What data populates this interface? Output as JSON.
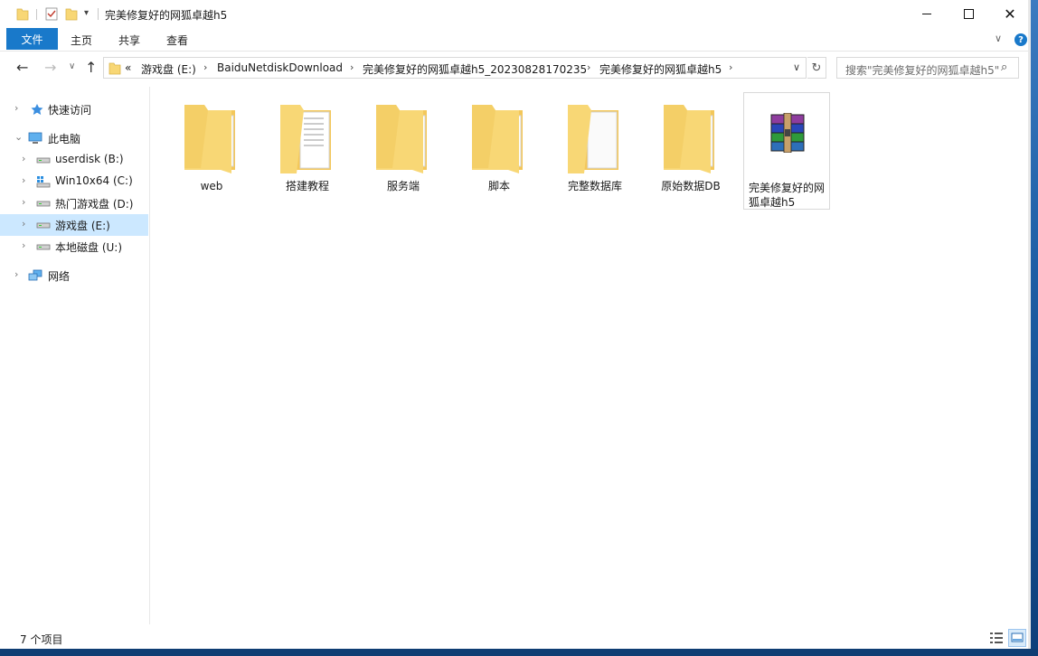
{
  "window": {
    "title": "完美修复好的网狐卓越h5"
  },
  "ribbon": {
    "file_tab": "文件",
    "tabs": [
      "主页",
      "共享",
      "查看"
    ]
  },
  "address": {
    "overflow": "«",
    "crumbs": [
      "游戏盘 (E:)",
      "BaiduNetdiskDownload",
      "完美修复好的网狐卓越h5_20230828170235",
      "完美修复好的网狐卓越h5"
    ]
  },
  "search": {
    "placeholder": "搜索\"完美修复好的网狐卓越h5\""
  },
  "sidebar": {
    "items": [
      {
        "label": "快速访问",
        "icon": "star-icon"
      },
      {
        "label": "此电脑",
        "icon": "computer-icon"
      },
      {
        "label": "userdisk (B:)",
        "icon": "drive-icon"
      },
      {
        "label": "Win10x64 (C:)",
        "icon": "windows-drive-icon"
      },
      {
        "label": "热门游戏盘 (D:)",
        "icon": "drive-icon"
      },
      {
        "label": "游戏盘 (E:)",
        "icon": "drive-icon"
      },
      {
        "label": "本地磁盘 (U:)",
        "icon": "drive-icon"
      },
      {
        "label": "网络",
        "icon": "network-icon"
      }
    ]
  },
  "files": [
    {
      "name": "web",
      "type": "folder"
    },
    {
      "name": "搭建教程",
      "type": "folder"
    },
    {
      "name": "服务端",
      "type": "folder"
    },
    {
      "name": "脚本",
      "type": "folder"
    },
    {
      "name": "完整数据库",
      "type": "folder"
    },
    {
      "name": "原始数据DB",
      "type": "folder"
    },
    {
      "name": "完美修复好的网狐卓越h5",
      "type": "rar-archive"
    }
  ],
  "status": {
    "count_text": "7 个项目"
  },
  "colors": {
    "accent": "#1979ca",
    "selection": "#cce8ff",
    "folder": "#f8d775"
  }
}
